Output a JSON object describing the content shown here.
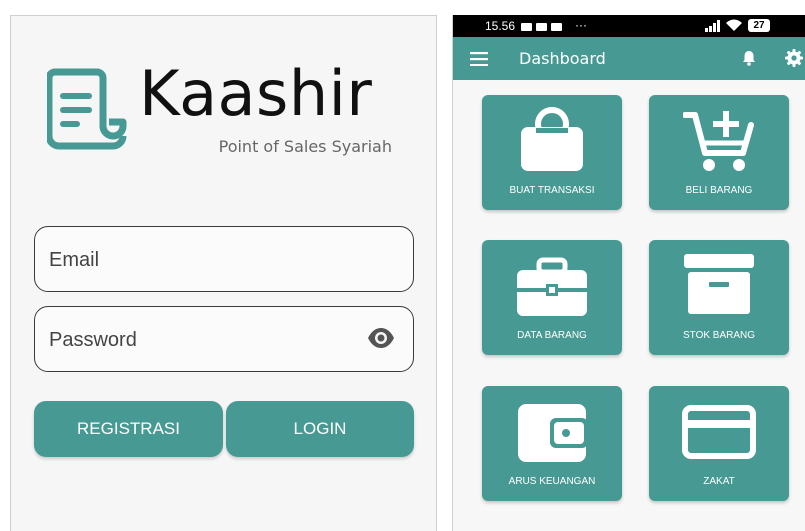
{
  "login": {
    "brand": "Kaashir",
    "tagline": "Point of Sales Syariah",
    "email_placeholder": "Email",
    "password_placeholder": "Password",
    "register_label": "REGISTRASI",
    "login_label": "LOGIN"
  },
  "dashboard": {
    "status": {
      "time": "15.56",
      "extra": "···",
      "battery": "27"
    },
    "title": "Dashboard",
    "tiles": [
      {
        "label": "BUAT TRANSAKSI",
        "icon": "shopping-bag-icon"
      },
      {
        "label": "BELI BARANG",
        "icon": "add-to-cart-icon"
      },
      {
        "label": "DATA BARANG",
        "icon": "briefcase-icon"
      },
      {
        "label": "STOK BARANG",
        "icon": "archive-box-icon"
      },
      {
        "label": "ARUS KEUANGAN",
        "icon": "wallet-icon"
      },
      {
        "label": "ZAKAT",
        "icon": "credit-card-icon"
      }
    ]
  },
  "colors": {
    "accent": "#479a93",
    "background": "#f6f6f6"
  }
}
